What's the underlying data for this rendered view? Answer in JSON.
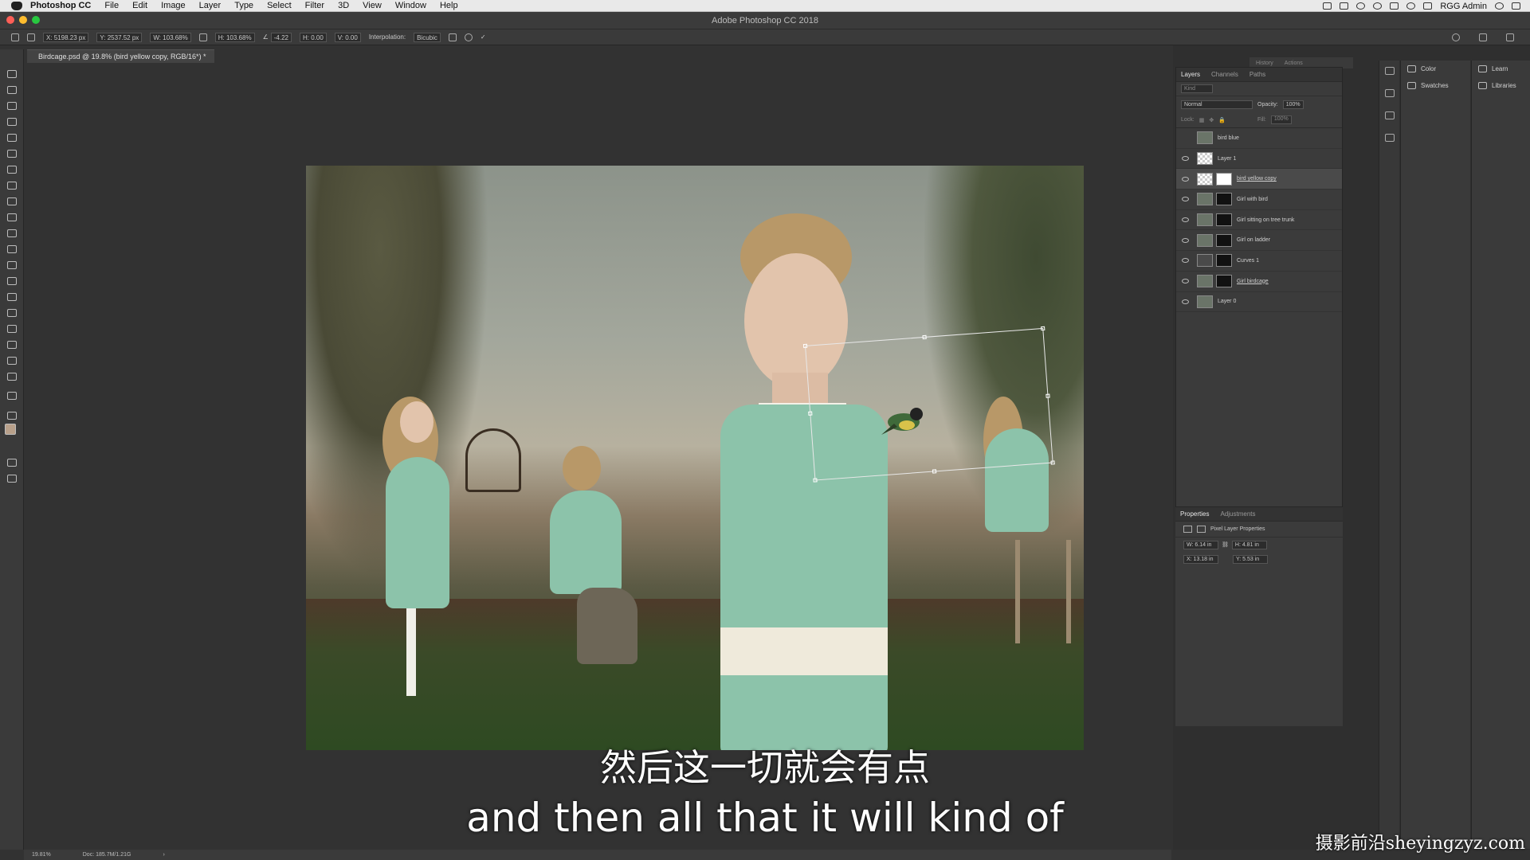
{
  "menubar": {
    "app_name": "Photoshop CC",
    "items": [
      "File",
      "Edit",
      "Image",
      "Layer",
      "Type",
      "Select",
      "Filter",
      "3D",
      "View",
      "Window",
      "Help"
    ],
    "user": "RGG Admin"
  },
  "window": {
    "title": "Adobe Photoshop CC 2018"
  },
  "options_bar": {
    "x": "X: 5198.23 px",
    "y": "Y: 2537.52 px",
    "w": "W: 103.68%",
    "h": "H: 103.68%",
    "angle": "-4.22",
    "h_skew": "H: 0.00",
    "v_skew": "V: 0.00",
    "interpolation_label": "Interpolation:",
    "interpolation_value": "Bicubic"
  },
  "document_tab": {
    "title": "Birdcage.psd @ 19.8% (bird yellow copy, RGB/16*) *"
  },
  "collapsed_panel_tabs": [
    "History",
    "Actions"
  ],
  "layers_panel": {
    "tabs": [
      "Layers",
      "Channels",
      "Paths"
    ],
    "filter_placeholder": "Kind",
    "blend_mode": "Normal",
    "opacity_label": "Opacity:",
    "opacity_value": "100%",
    "lock_label": "Lock:",
    "fill_label": "Fill:",
    "fill_value": "100%",
    "layers": [
      {
        "name": "bird blue",
        "visible": false
      },
      {
        "name": "Layer 1",
        "visible": true
      },
      {
        "name": "bird yellow copy",
        "visible": true,
        "selected": true
      },
      {
        "name": "Girl with bird",
        "visible": true
      },
      {
        "name": "Girl sitting on tree trunk",
        "visible": true
      },
      {
        "name": "Girl on ladder",
        "visible": true
      },
      {
        "name": "Curves 1",
        "visible": true
      },
      {
        "name": "Girl birdcage",
        "visible": true
      },
      {
        "name": "Layer 0",
        "visible": true
      }
    ]
  },
  "properties_panel": {
    "tabs": [
      "Properties",
      "Adjustments"
    ],
    "title": "Pixel Layer Properties",
    "w": "W: 6.14 in",
    "h": "H: 4.81 in",
    "x": "X: 13.18 in",
    "y": "Y: 5.53 in"
  },
  "dock": {
    "color": "Color",
    "swatches": "Swatches",
    "learn": "Learn",
    "libraries": "Libraries"
  },
  "status_bar": {
    "zoom": "19.81%",
    "doc": "Doc: 185.7M/1.21G"
  },
  "subtitles": {
    "zh": "然后这一切就会有点",
    "en": "and then all that it will kind of"
  },
  "watermark": "摄影前沿sheyingzyz.com",
  "colors": {
    "canvas_bg": "#323232",
    "panel_bg": "#3b3b3b",
    "dress": "#8cc3aa"
  }
}
